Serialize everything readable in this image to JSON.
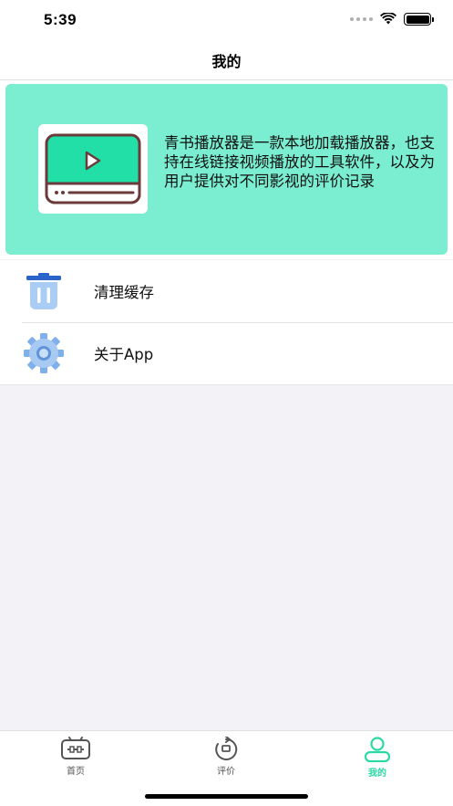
{
  "status_bar": {
    "time": "5:39"
  },
  "nav": {
    "title": "我的"
  },
  "banner": {
    "description": "青书播放器是一款本地加载播放器，也支持在线链接视频播放的工具软件，以及为用户提供对不同影视的评价记录",
    "background_color": "#7bedd0",
    "logo_icon": "video-player-icon"
  },
  "menu": {
    "items": [
      {
        "label": "清理缓存",
        "icon": "trash-icon"
      },
      {
        "label": "关于App",
        "icon": "gear-icon"
      }
    ]
  },
  "tab_bar": {
    "tabs": [
      {
        "label": "首页",
        "icon": "tv-icon",
        "active": false
      },
      {
        "label": "评价",
        "icon": "refresh-icon",
        "active": false
      },
      {
        "label": "我的",
        "icon": "user-icon",
        "active": true
      }
    ],
    "active_color": "#2bd9a5"
  }
}
